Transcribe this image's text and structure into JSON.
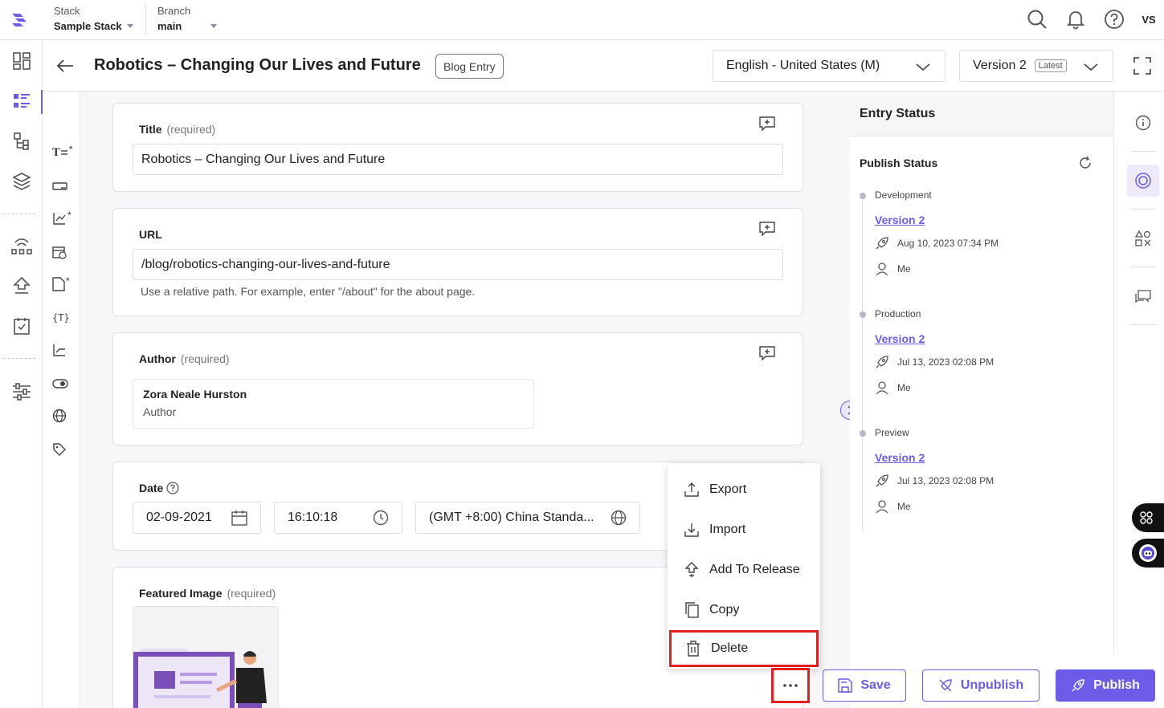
{
  "topbar": {
    "stack_label": "Stack",
    "stack_value": "Sample Stack",
    "branch_label": "Branch",
    "branch_value": "main",
    "avatar_initials": "VS"
  },
  "header": {
    "entry_title": "Robotics – Changing Our Lives and Future",
    "content_type_badge": "Blog Entry",
    "language": "English - United States (M)",
    "version": "Version 2",
    "version_badge": "Latest"
  },
  "fields": {
    "title": {
      "label": "Title",
      "required": "(required)",
      "value": "Robotics – Changing Our Lives and Future"
    },
    "url": {
      "label": "URL",
      "value": "/blog/robotics-changing-our-lives-and-future",
      "help": "Use a relative path. For example, enter \"/about\" for the about page."
    },
    "author": {
      "label": "Author",
      "required": "(required)",
      "ref_name": "Zora Neale Hurston",
      "ref_type": "Author"
    },
    "date": {
      "label": "Date",
      "date": "02-09-2021",
      "time": "16:10:18",
      "timezone": "(GMT +8:00) China Standa..."
    },
    "featured_image": {
      "label": "Featured Image",
      "required": "(required)"
    }
  },
  "status_panel": {
    "heading": "Entry Status",
    "publish_status": "Publish Status",
    "environments": [
      {
        "name": "Development",
        "version": "Version 2",
        "date": "Aug 10, 2023 07:34 PM",
        "user": "Me"
      },
      {
        "name": "Production",
        "version": "Version 2",
        "date": "Jul 13, 2023 02:08 PM",
        "user": "Me"
      },
      {
        "name": "Preview",
        "version": "Version 2",
        "date": "Jul 13, 2023 02:08 PM",
        "user": "Me"
      }
    ]
  },
  "menu": {
    "items": [
      {
        "label": "Export",
        "icon": "export-icon"
      },
      {
        "label": "Import",
        "icon": "import-icon"
      },
      {
        "label": "Add To Release",
        "icon": "release-icon"
      },
      {
        "label": "Copy",
        "icon": "copy-icon"
      },
      {
        "label": "Delete",
        "icon": "trash-icon"
      }
    ]
  },
  "actions": {
    "save": "Save",
    "unpublish": "Unpublish",
    "publish": "Publish"
  },
  "colors": {
    "accent": "#6c5ce7",
    "highlight": "#e0201f"
  }
}
